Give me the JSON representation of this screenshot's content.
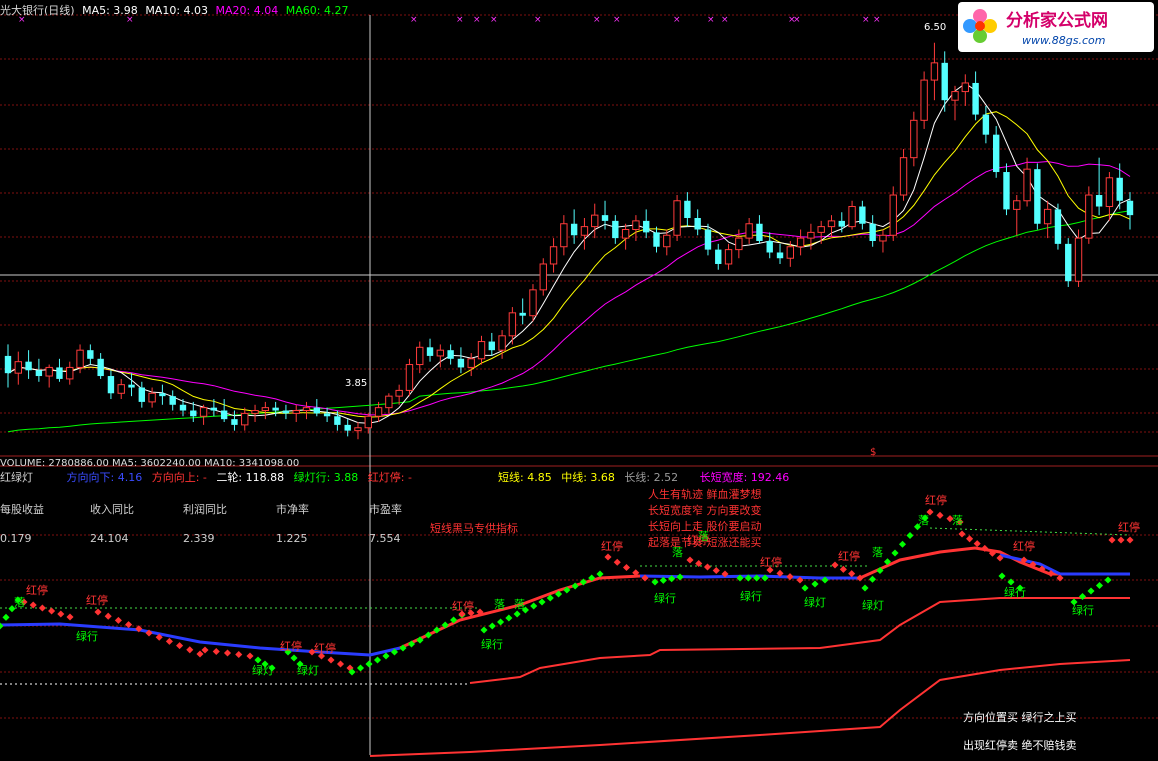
{
  "header": {
    "title": "光大银行(日线)",
    "ma5": "MA5: 3.98",
    "ma10": "MA10: 4.03",
    "ma20": "MA20: 4.04",
    "ma60": "MA60: 4.27"
  },
  "volume_bar": {
    "text": "VOLUME: 2780886.00  MA5: 3602240.00  MA10: 3341098.00"
  },
  "indicator_bar": {
    "name": "红绿灯",
    "direction_down": "方向向下: 4.16",
    "direction_up": "方向向上: -",
    "second_round": "二轮: 118.88",
    "green_light": "绿灯行: 3.88",
    "red_stop": "红灯停: -",
    "short_line": "短线: 4.85",
    "mid_line": "中线: 3.68",
    "long_line": "长线: 2.52",
    "long_short_width": "长短宽度: 192.46"
  },
  "fundamentals": {
    "headers": [
      "每股收益",
      "收入同比",
      "利润同比",
      "市净率",
      "市盈率"
    ],
    "values": [
      "0.179",
      "24.104",
      "2.339",
      "1.225",
      "7.554"
    ]
  },
  "notes": {
    "promo": "短线黑马专供指标",
    "poem": [
      "人生有轨迹 鲜血灌梦想",
      "长短宽度窄 方向要改变",
      "长短向上走 股价要启动",
      "起落是节奏 短涨还能买"
    ],
    "footer1": "方向位置买 绿行之上买",
    "footer2": "出现红停卖 绝不赔钱卖"
  },
  "logo": {
    "brand": "分析家公式网",
    "url": "www.88gs.com"
  },
  "colors": {
    "up": "#ff3b3b",
    "down": "#54ffff",
    "ma5": "#ffffff",
    "ma10": "#ffff00",
    "ma20": "#ff00ff",
    "ma60": "#00ff00",
    "signal_green": "#00ff00",
    "signal_red": "#ff3333",
    "line_blue": "#2a3cff",
    "grid": "#801010"
  },
  "chart_data": {
    "type": "candlestick",
    "price_axis_range": [
      3.7,
      6.7
    ],
    "high_marker": "6.50",
    "low_marker": "3.85",
    "ohlc": [
      [
        4.32,
        4.4,
        4.1,
        4.2
      ],
      [
        4.2,
        4.35,
        4.12,
        4.28
      ],
      [
        4.28,
        4.36,
        4.16,
        4.22
      ],
      [
        4.22,
        4.3,
        4.14,
        4.18
      ],
      [
        4.18,
        4.26,
        4.1,
        4.24
      ],
      [
        4.24,
        4.3,
        4.14,
        4.16
      ],
      [
        4.16,
        4.28,
        4.12,
        4.24
      ],
      [
        4.24,
        4.4,
        4.2,
        4.36
      ],
      [
        4.36,
        4.4,
        4.26,
        4.3
      ],
      [
        4.3,
        4.34,
        4.16,
        4.18
      ],
      [
        4.18,
        4.22,
        4.02,
        4.06
      ],
      [
        4.06,
        4.16,
        4.02,
        4.12
      ],
      [
        4.12,
        4.2,
        4.04,
        4.1
      ],
      [
        4.1,
        4.14,
        3.96,
        4.0
      ],
      [
        4.0,
        4.1,
        3.96,
        4.06
      ],
      [
        4.06,
        4.12,
        3.98,
        4.04
      ],
      [
        4.04,
        4.08,
        3.94,
        3.98
      ],
      [
        3.98,
        4.02,
        3.9,
        3.94
      ],
      [
        3.94,
        4.0,
        3.86,
        3.9
      ],
      [
        3.9,
        3.98,
        3.84,
        3.96
      ],
      [
        3.96,
        4.02,
        3.9,
        3.94
      ],
      [
        3.94,
        4.02,
        3.86,
        3.88
      ],
      [
        3.88,
        3.94,
        3.8,
        3.84
      ],
      [
        3.84,
        3.96,
        3.8,
        3.92
      ],
      [
        3.92,
        3.98,
        3.86,
        3.94
      ],
      [
        3.94,
        4.0,
        3.88,
        3.96
      ],
      [
        3.96,
        4.0,
        3.9,
        3.94
      ],
      [
        3.94,
        3.98,
        3.88,
        3.92
      ],
      [
        3.92,
        3.98,
        3.86,
        3.94
      ],
      [
        3.94,
        4.0,
        3.88,
        3.96
      ],
      [
        3.96,
        4.02,
        3.9,
        3.92
      ],
      [
        3.92,
        3.96,
        3.86,
        3.9
      ],
      [
        3.9,
        3.94,
        3.8,
        3.84
      ],
      [
        3.84,
        3.88,
        3.76,
        3.8
      ],
      [
        3.8,
        3.86,
        3.74,
        3.82
      ],
      [
        3.82,
        3.92,
        3.78,
        3.9
      ],
      [
        3.9,
        4.0,
        3.86,
        3.96
      ],
      [
        3.96,
        4.06,
        3.92,
        4.04
      ],
      [
        4.04,
        4.12,
        3.98,
        4.08
      ],
      [
        4.08,
        4.3,
        4.04,
        4.26
      ],
      [
        4.26,
        4.42,
        4.2,
        4.38
      ],
      [
        4.38,
        4.44,
        4.28,
        4.32
      ],
      [
        4.32,
        4.4,
        4.24,
        4.36
      ],
      [
        4.36,
        4.4,
        4.26,
        4.3
      ],
      [
        4.3,
        4.38,
        4.2,
        4.24
      ],
      [
        4.24,
        4.34,
        4.18,
        4.3
      ],
      [
        4.3,
        4.46,
        4.26,
        4.42
      ],
      [
        4.42,
        4.48,
        4.32,
        4.36
      ],
      [
        4.36,
        4.5,
        4.3,
        4.46
      ],
      [
        4.46,
        4.66,
        4.4,
        4.62
      ],
      [
        4.62,
        4.72,
        4.54,
        4.6
      ],
      [
        4.6,
        4.82,
        4.56,
        4.78
      ],
      [
        4.78,
        5.0,
        4.74,
        4.96
      ],
      [
        4.96,
        5.14,
        4.9,
        5.08
      ],
      [
        5.08,
        5.3,
        5.02,
        5.24
      ],
      [
        5.24,
        5.34,
        5.1,
        5.16
      ],
      [
        5.16,
        5.28,
        5.06,
        5.22
      ],
      [
        5.22,
        5.38,
        5.14,
        5.3
      ],
      [
        5.3,
        5.4,
        5.2,
        5.26
      ],
      [
        5.26,
        5.3,
        5.1,
        5.14
      ],
      [
        5.14,
        5.24,
        5.06,
        5.2
      ],
      [
        5.2,
        5.3,
        5.12,
        5.26
      ],
      [
        5.26,
        5.34,
        5.14,
        5.18
      ],
      [
        5.18,
        5.22,
        5.04,
        5.08
      ],
      [
        5.08,
        5.2,
        5.02,
        5.16
      ],
      [
        5.16,
        5.44,
        5.12,
        5.4
      ],
      [
        5.4,
        5.46,
        5.22,
        5.28
      ],
      [
        5.28,
        5.34,
        5.16,
        5.2
      ],
      [
        5.2,
        5.24,
        5.02,
        5.06
      ],
      [
        5.06,
        5.1,
        4.92,
        4.96
      ],
      [
        4.96,
        5.1,
        4.92,
        5.06
      ],
      [
        5.06,
        5.2,
        5.0,
        5.14
      ],
      [
        5.14,
        5.28,
        5.1,
        5.24
      ],
      [
        5.24,
        5.3,
        5.1,
        5.12
      ],
      [
        5.12,
        5.18,
        5.0,
        5.04
      ],
      [
        5.04,
        5.1,
        4.96,
        5.0
      ],
      [
        5.0,
        5.12,
        4.94,
        5.08
      ],
      [
        5.08,
        5.2,
        5.02,
        5.14
      ],
      [
        5.14,
        5.24,
        5.06,
        5.18
      ],
      [
        5.18,
        5.26,
        5.1,
        5.22
      ],
      [
        5.22,
        5.3,
        5.14,
        5.26
      ],
      [
        5.26,
        5.32,
        5.18,
        5.22
      ],
      [
        5.22,
        5.4,
        5.2,
        5.36
      ],
      [
        5.36,
        5.4,
        5.2,
        5.24
      ],
      [
        5.24,
        5.3,
        5.08,
        5.12
      ],
      [
        5.12,
        5.2,
        5.04,
        5.16
      ],
      [
        5.16,
        5.5,
        5.12,
        5.44
      ],
      [
        5.44,
        5.76,
        5.4,
        5.7
      ],
      [
        5.7,
        6.02,
        5.64,
        5.96
      ],
      [
        5.96,
        6.3,
        5.9,
        6.24
      ],
      [
        6.24,
        6.5,
        6.1,
        6.36
      ],
      [
        6.36,
        6.44,
        6.02,
        6.1
      ],
      [
        6.1,
        6.2,
        5.96,
        6.16
      ],
      [
        6.16,
        6.28,
        6.06,
        6.22
      ],
      [
        6.22,
        6.3,
        5.96,
        6.0
      ],
      [
        6.0,
        6.06,
        5.8,
        5.86
      ],
      [
        5.86,
        5.92,
        5.56,
        5.6
      ],
      [
        5.6,
        5.66,
        5.3,
        5.34
      ],
      [
        5.34,
        5.44,
        5.16,
        5.4
      ],
      [
        5.4,
        5.7,
        5.36,
        5.62
      ],
      [
        5.62,
        5.66,
        5.2,
        5.24
      ],
      [
        5.24,
        5.4,
        5.14,
        5.34
      ],
      [
        5.34,
        5.38,
        5.06,
        5.1
      ],
      [
        5.1,
        5.14,
        4.8,
        4.84
      ],
      [
        4.84,
        5.2,
        4.8,
        5.14
      ],
      [
        5.14,
        5.5,
        5.1,
        5.44
      ],
      [
        5.44,
        5.7,
        5.3,
        5.36
      ],
      [
        5.36,
        5.6,
        5.26,
        5.56
      ],
      [
        5.56,
        5.66,
        5.34,
        5.4
      ],
      [
        5.4,
        5.46,
        5.2,
        5.3
      ]
    ],
    "signals": {
      "red_stop": "红停",
      "green_go": "绿行",
      "green_light": "绿灯",
      "fall": "落"
    }
  }
}
